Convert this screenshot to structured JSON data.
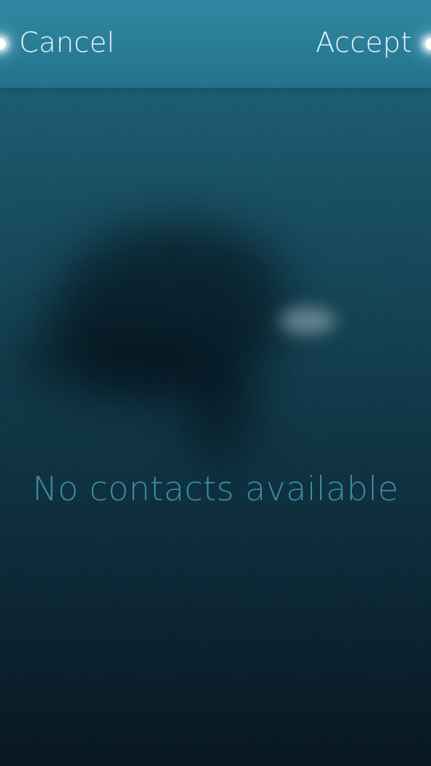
{
  "header": {
    "cancel_label": "Cancel",
    "accept_label": "Accept"
  },
  "main": {
    "empty_message": "No contacts available"
  },
  "colors": {
    "header_accent": "#3ca0be",
    "text_primary": "#e9f6fb",
    "empty_text": "#3e8ba6",
    "background_top": "#1f6a80",
    "background_bottom": "#061620"
  }
}
